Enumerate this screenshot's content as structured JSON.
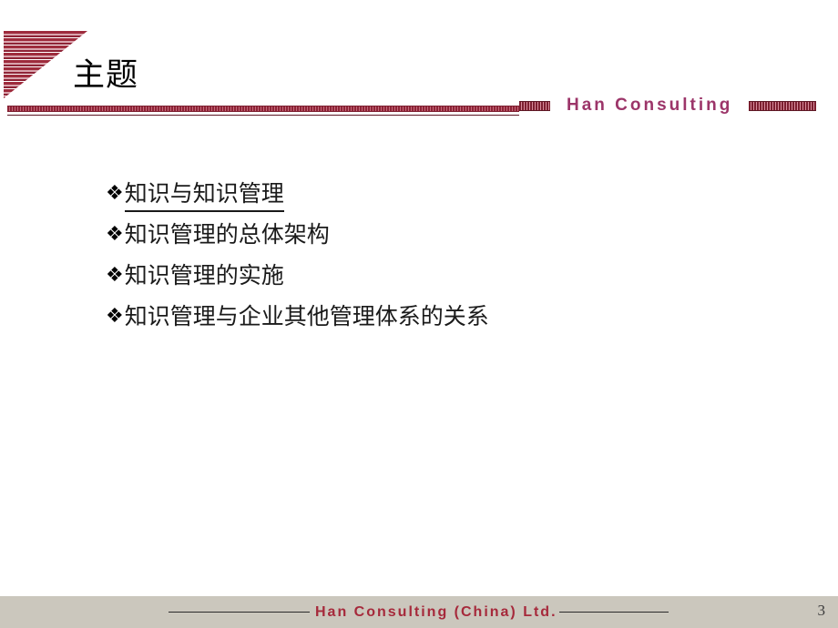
{
  "slide": {
    "title": "主题",
    "page_number": "3",
    "accent_color": "#8e2336",
    "brand_color": "#9c3569",
    "footer_text_color": "#a6293b",
    "footer_band_color": "#cbc7bd",
    "background_color": "#ffffff"
  },
  "header": {
    "brand": "Han  Consulting",
    "corner_icon": "striped-triangle-icon",
    "dash_left_icon": "striped-dash-icon",
    "dash_right_icon": "striped-dash-icon"
  },
  "content": {
    "bullet_marker": "❖",
    "bullets": [
      {
        "text": "知识与知识管理",
        "underlined": true
      },
      {
        "text": "知识管理的总体架构",
        "underlined": false
      },
      {
        "text": "知识管理的实施",
        "underlined": false
      },
      {
        "text": "知识管理与企业其他管理体系的关系",
        "underlined": false
      }
    ]
  },
  "footer": {
    "text": "Han Consulting (China) Ltd.",
    "page_number": "3"
  }
}
